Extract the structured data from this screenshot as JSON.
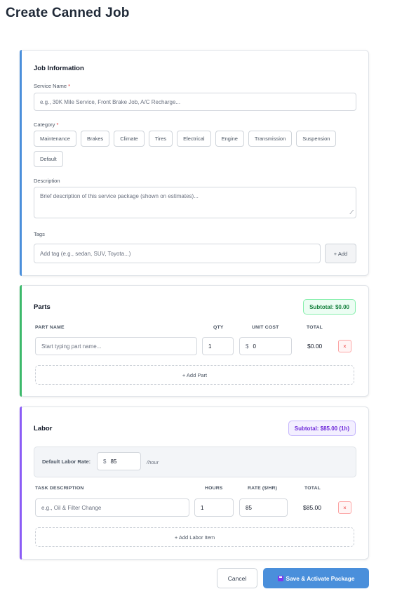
{
  "page": {
    "title": "Create Canned Job"
  },
  "job_info": {
    "title": "Job Information",
    "service_name_label": "Service Name",
    "service_name_placeholder": "e.g., 30K Mile Service, Front Brake Job, A/C Recharge...",
    "category_label": "Category",
    "required_mark": "*",
    "categories": [
      "Maintenance",
      "Brakes",
      "Climate",
      "Tires",
      "Electrical",
      "Engine",
      "Transmission",
      "Suspension",
      "Default"
    ],
    "description_label": "Description",
    "description_placeholder": "Brief description of this service package (shown on estimates)...",
    "tags_label": "Tags",
    "tag_placeholder": "Add tag (e.g., sedan, SUV, Toyota...)",
    "add_tag_label": "+ Add"
  },
  "parts": {
    "title": "Parts",
    "subtotal": "Subtotal: $0.00",
    "headers": {
      "name": "PART NAME",
      "qty": "QTY",
      "unit_cost": "UNIT COST",
      "total": "TOTAL"
    },
    "rows": [
      {
        "name_placeholder": "Start typing part name...",
        "qty": "1",
        "currency": "$",
        "unit_cost": "0",
        "total": "$0.00",
        "remove": "×"
      }
    ],
    "add_label": "+ Add Part"
  },
  "labor": {
    "title": "Labor",
    "subtotal": "Subtotal: $85.00 (1h)",
    "default_rate_label": "Default Labor Rate:",
    "currency": "$",
    "default_rate": "85",
    "per_hour": "/hour",
    "headers": {
      "task": "TASK DESCRIPTION",
      "hours": "HOURS",
      "rate": "RATE ($/HR)",
      "total": "TOTAL"
    },
    "rows": [
      {
        "task_placeholder": "e.g., Oil & Filter Change",
        "hours": "1",
        "rate": "85",
        "total": "$85.00",
        "remove": "×"
      }
    ],
    "add_label": "+ Add Labor Item"
  },
  "actions": {
    "cancel": "Cancel",
    "save": "Save & Activate Package",
    "save_icon": "floppy-disk-icon"
  },
  "colors": {
    "accent_blue": "#4a8fdb",
    "accent_green": "#3cb96b",
    "accent_purple": "#8b5cf6"
  }
}
